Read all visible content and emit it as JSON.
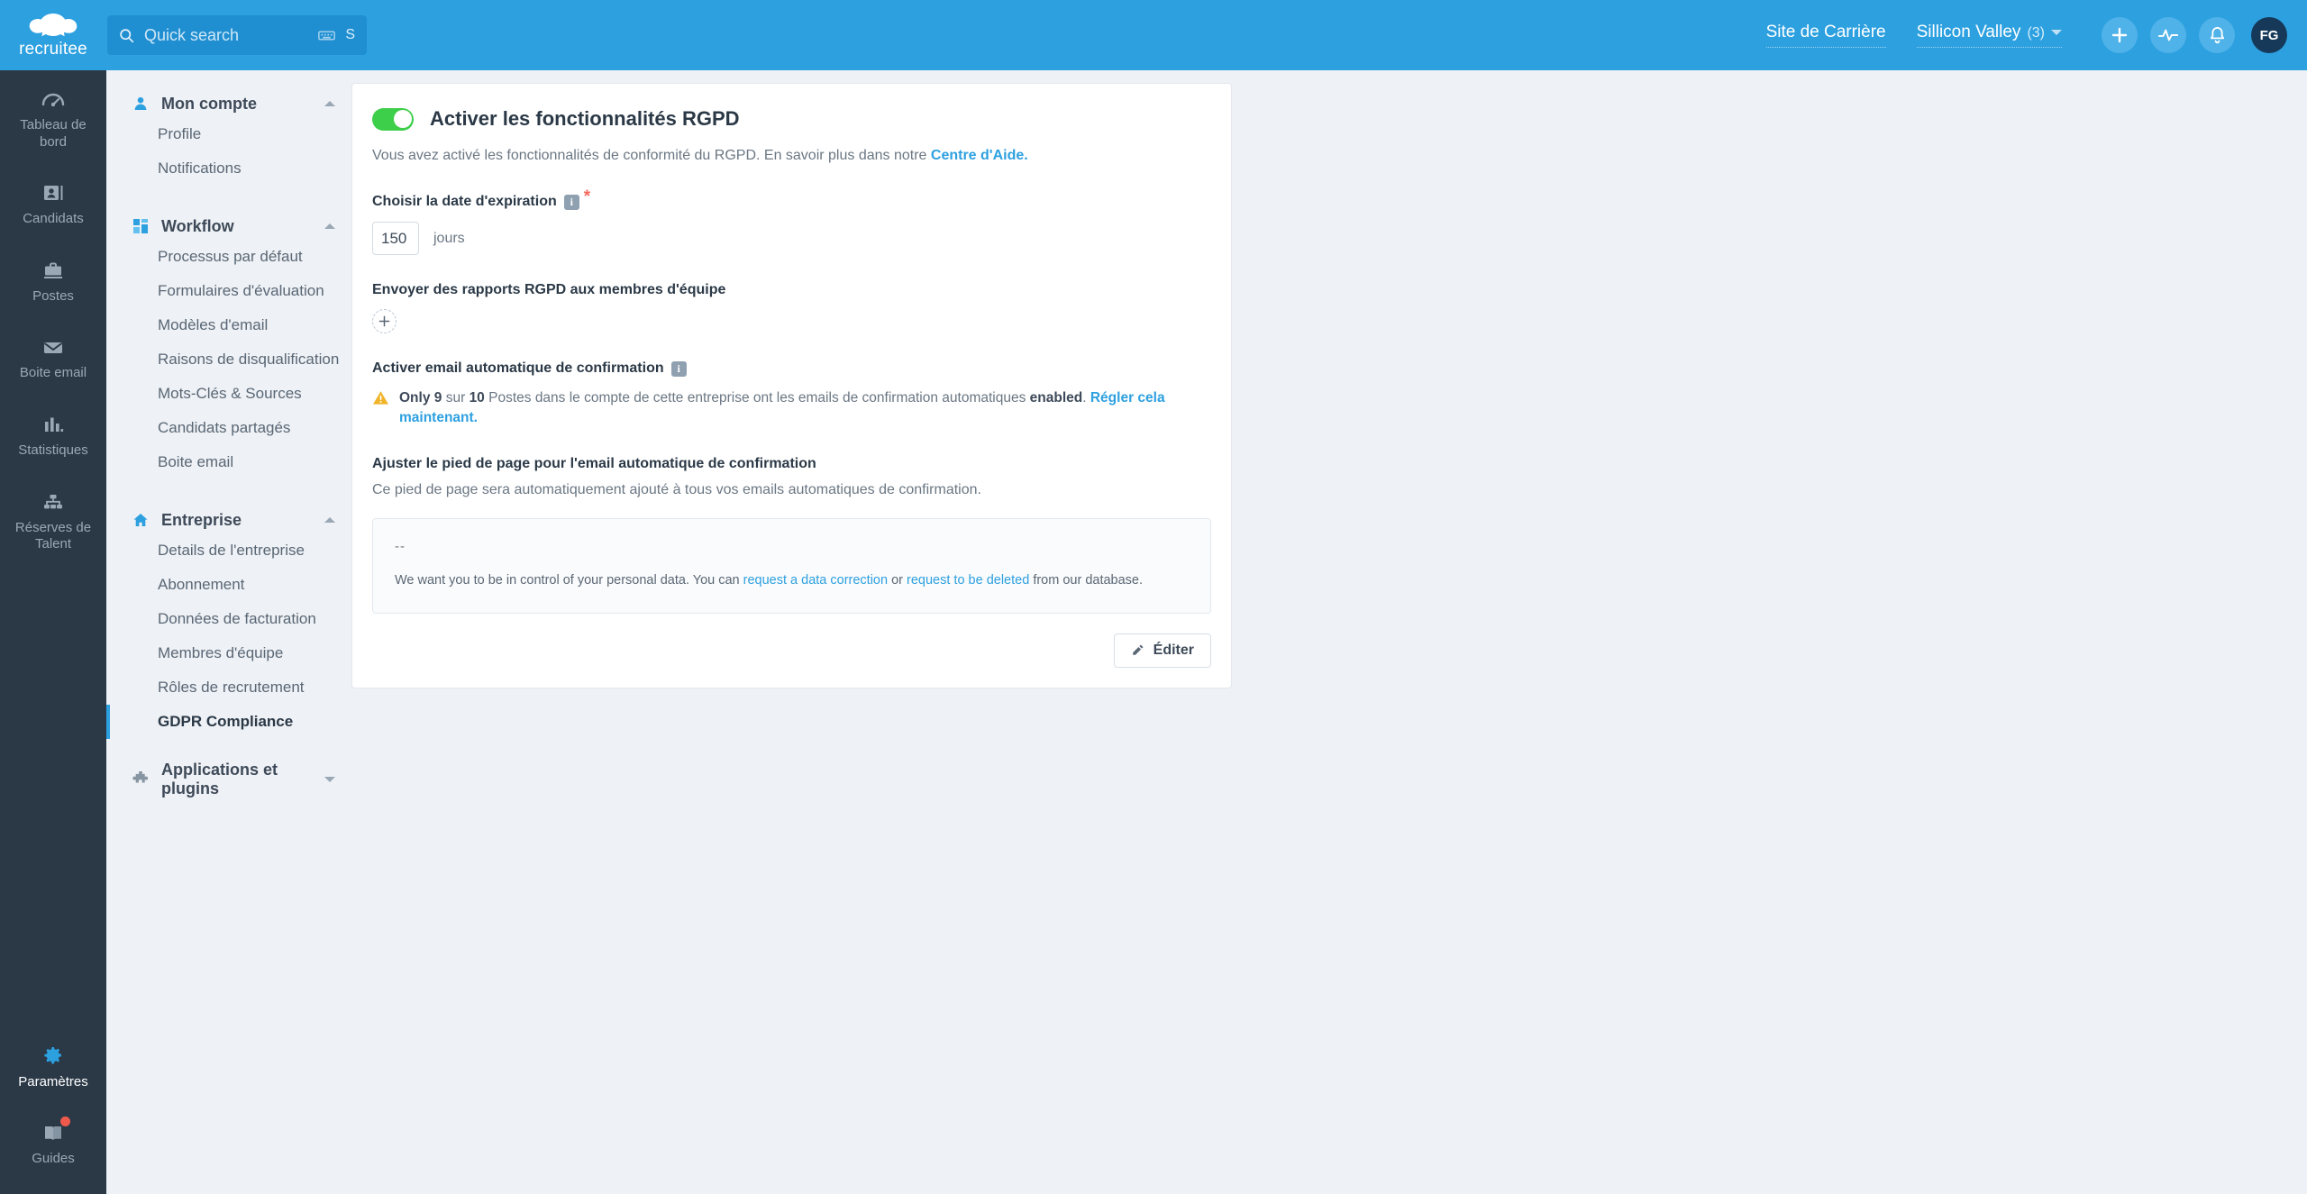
{
  "topbar": {
    "brand": "recruitee",
    "brand_icon": "recruitee-logo-icon",
    "search": {
      "icon": "search-icon",
      "placeholder": "Quick search",
      "kbd_icon": "keyboard-icon",
      "kbd_key": "S"
    },
    "career_site_label": "Site de Carrière",
    "company_name": "Sillicon Valley",
    "company_count": "(3)",
    "dropdown_icon": "chevron-down-icon",
    "add_icon": "plus-icon",
    "activity_icon": "activity-pulse-icon",
    "notifications_icon": "bell-icon",
    "avatar_initials": "FG",
    "accent_color": "#2da0e0"
  },
  "rail": {
    "items": [
      {
        "label": "Tableau de bord",
        "icon": "dashboard-gauge-icon",
        "active": false
      },
      {
        "label": "Candidats",
        "icon": "candidates-person-icon",
        "active": false
      },
      {
        "label": "Postes",
        "icon": "jobs-briefcase-icon",
        "active": false
      },
      {
        "label": "Boite email",
        "icon": "mailbox-envelope-icon",
        "active": false
      },
      {
        "label": "Statistiques",
        "icon": "statistics-bars-icon",
        "active": false
      },
      {
        "label": "Réserves de Talent",
        "icon": "talent-pool-hierarchy-icon",
        "active": false
      }
    ],
    "bottom_items": [
      {
        "label": "Paramètres",
        "icon": "gear-icon",
        "active": true,
        "badge": false
      },
      {
        "label": "Guides",
        "icon": "guides-book-icon",
        "active": false,
        "badge": true
      }
    ]
  },
  "settings_nav": {
    "groups": [
      {
        "title": "Mon compte",
        "icon": "person-icon",
        "expanded": true,
        "items": [
          {
            "label": "Profile",
            "active": false
          },
          {
            "label": "Notifications",
            "active": false
          }
        ]
      },
      {
        "title": "Workflow",
        "icon": "workflow-grid-icon",
        "expanded": true,
        "items": [
          {
            "label": "Processus par défaut",
            "active": false
          },
          {
            "label": "Formulaires d'évaluation",
            "active": false
          },
          {
            "label": "Modèles d'email",
            "active": false
          },
          {
            "label": "Raisons de disqualification",
            "active": false
          },
          {
            "label": "Mots-Clés & Sources",
            "active": false
          },
          {
            "label": "Candidats partagés",
            "active": false
          },
          {
            "label": "Boite email",
            "active": false
          }
        ]
      },
      {
        "title": "Entreprise",
        "icon": "home-icon",
        "expanded": true,
        "items": [
          {
            "label": "Details de l'entreprise",
            "active": false
          },
          {
            "label": "Abonnement",
            "active": false
          },
          {
            "label": "Données de facturation",
            "active": false
          },
          {
            "label": "Membres d'équipe",
            "active": false
          },
          {
            "label": "Rôles de recrutement",
            "active": false
          },
          {
            "label": "GDPR Compliance",
            "active": true
          }
        ]
      },
      {
        "title": "Applications et plugins",
        "icon": "puzzle-piece-icon",
        "expanded": false,
        "items": []
      }
    ]
  },
  "card": {
    "toggle_on": true,
    "title": "Activer les fonctionnalités RGPD",
    "description_before": "Vous avez activé les fonctionnalités de conformité du RGPD. En savoir plus dans notre",
    "description_link": "Centre d'Aide.",
    "expiration_label": "Choisir la date d'expiration",
    "expiration_info_icon": "info-icon",
    "expiration_required": "*",
    "days_value": "150",
    "days_unit": "jours",
    "reports_label": "Envoyer des rapports RGPD aux membres d'équipe",
    "add_icon": "plus-icon",
    "autoemail_label": "Activer email automatique de confirmation",
    "autoemail_info_icon": "info-icon",
    "warning_icon": "warning-triangle-icon",
    "warning_only": "Only 9",
    "warning_sur": "sur",
    "warning_total": "10",
    "warning_middle": "Postes dans le compte de cette entreprise ont les emails de confirmation automatiques",
    "warning_enabled": "enabled",
    "warning_period": ".",
    "warning_link": "Régler cela maintenant.",
    "footer_label": "Ajuster le pied de page pour l'email automatique de confirmation",
    "footer_sub": "Ce pied de page sera automatiquement ajouté à tous vos emails automatiques de confirmation.",
    "signature_dashes": "-- ",
    "signature_before": "We want you to be in control of your personal data. You can",
    "signature_link1": "request a data correction",
    "signature_or": "or",
    "signature_link2": "request to be deleted",
    "signature_after": "from our database.",
    "edit_icon": "pencil-icon",
    "edit_label": "Éditer",
    "toggle_color": "#3dce4a",
    "link_color": "#2da0e0",
    "warning_color": "#f0b429"
  }
}
